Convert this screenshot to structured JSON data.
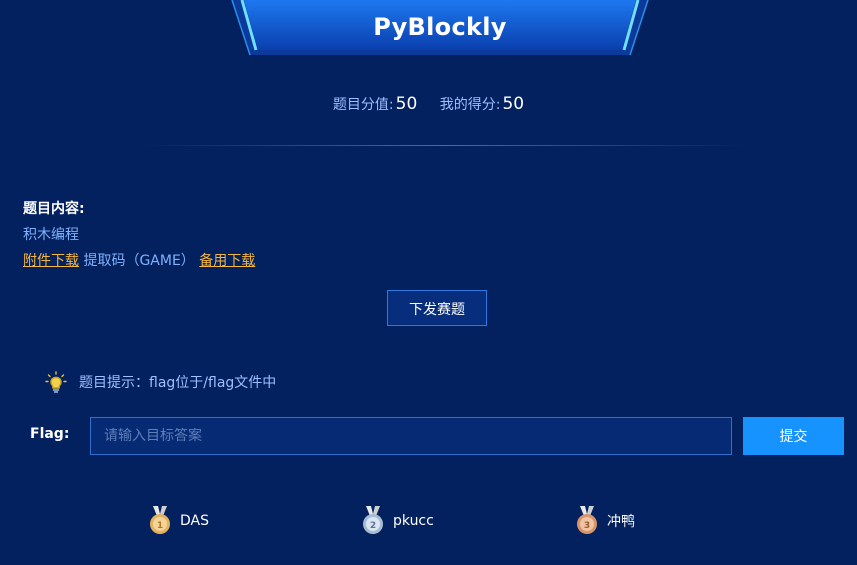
{
  "challenge": {
    "title": "PyBlockly"
  },
  "score": {
    "value_label": "题目分值:",
    "value": "50",
    "my_label": "我的得分:",
    "my": "50"
  },
  "content": {
    "label": "题目内容:",
    "description": "积木编程",
    "attachment_link": "附件下载",
    "extract_code": "提取码（GAME）",
    "backup_link": "备用下载"
  },
  "actions": {
    "issue_label": "下发赛题",
    "submit_label": "提交"
  },
  "hint": {
    "text": "题目提示：flag位于/flag文件中",
    "icon": "lightbulb-icon"
  },
  "flag": {
    "label": "Flag:",
    "placeholder": "请输入目标答案",
    "value": ""
  },
  "rankings": [
    {
      "place": "1",
      "team": "DAS",
      "icon": "gold-medal-icon"
    },
    {
      "place": "2",
      "team": "pkucc",
      "icon": "silver-medal-icon"
    },
    {
      "place": "3",
      "team": "冲鸭",
      "icon": "bronze-medal-icon"
    }
  ],
  "colors": {
    "background": "#03205f",
    "accent": "#1693ff",
    "link_gold": "#f4b63c",
    "text_blue": "#7fb2ff"
  }
}
